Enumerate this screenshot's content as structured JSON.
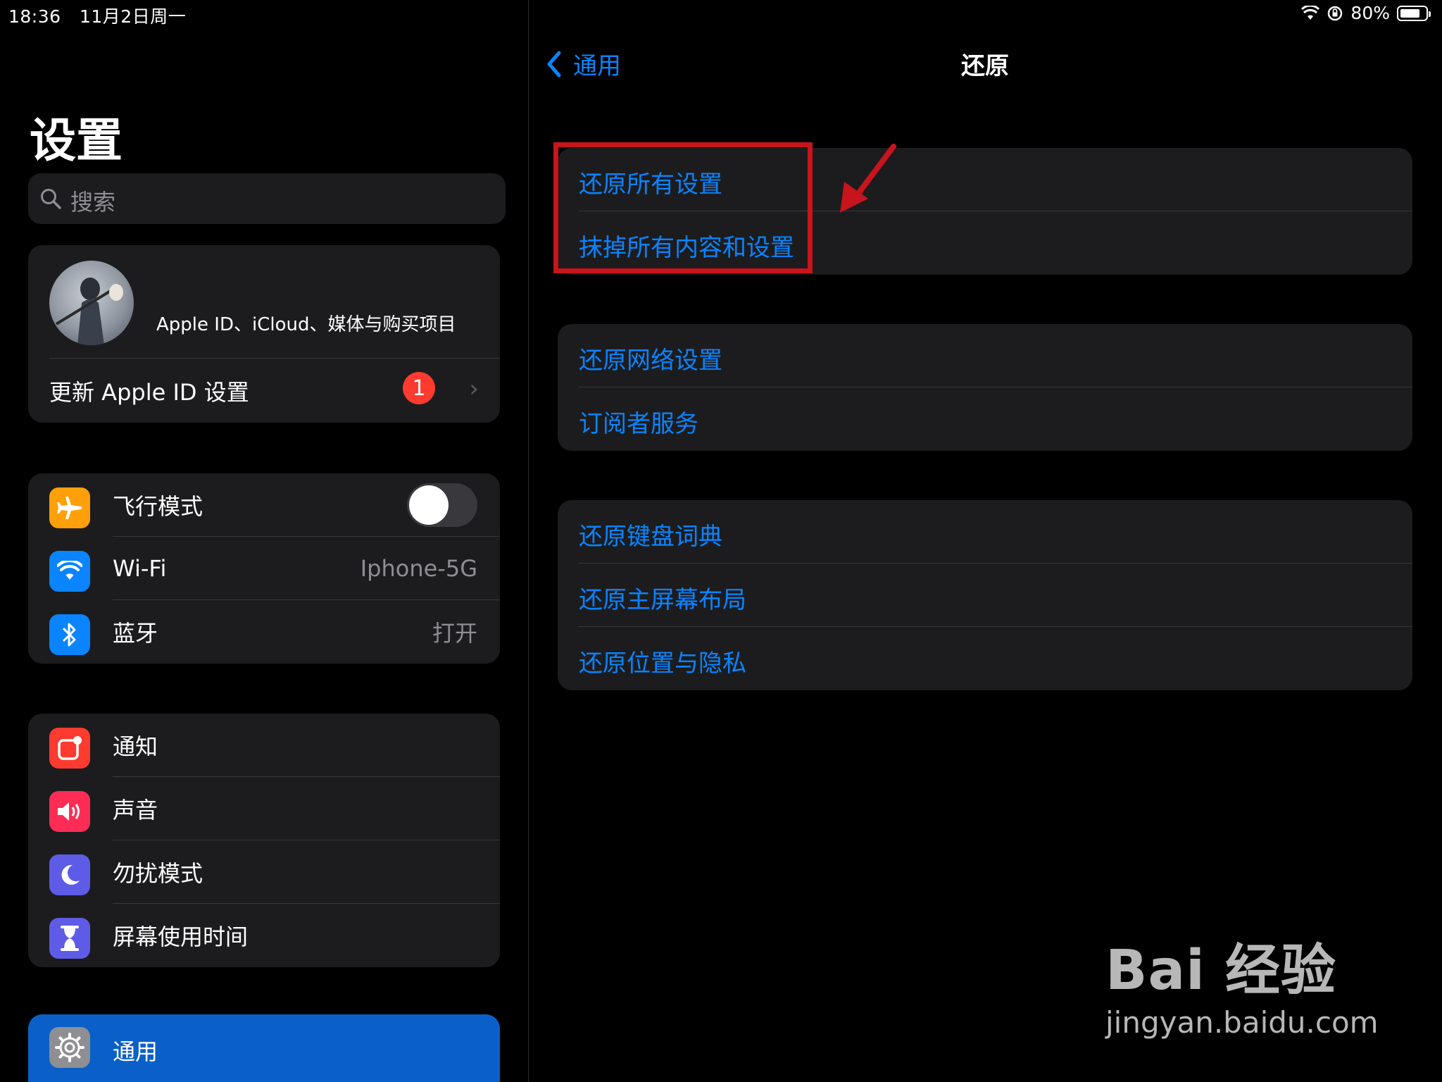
{
  "status_bar": {
    "time": "18:36",
    "date": "11月2日周一",
    "battery_pct": "80%",
    "battery_level": 0.8
  },
  "sidebar": {
    "title": "设置",
    "search_placeholder": "搜索",
    "profile": {
      "subtitle": "Apple ID、iCloud、媒体与购买项目",
      "update_label": "更新 Apple ID 设置",
      "badge_count": "1"
    },
    "connectivity": [
      {
        "label": "飞行模式",
        "value": "",
        "icon": "airplane-icon",
        "color": "#ff9f0a",
        "toggle_on": false
      },
      {
        "label": "Wi-Fi",
        "value": "Iphone-5G",
        "icon": "wifi-icon",
        "color": "#0a84ff"
      },
      {
        "label": "蓝牙",
        "value": "打开",
        "icon": "bluetooth-icon",
        "color": "#0a84ff"
      }
    ],
    "system": [
      {
        "label": "通知",
        "icon": "notifications-icon",
        "color": "#ff3b30"
      },
      {
        "label": "声音",
        "icon": "sound-icon",
        "color": "#ff2d55"
      },
      {
        "label": "勿扰模式",
        "icon": "moon-icon",
        "color": "#5e5ce6"
      },
      {
        "label": "屏幕使用时间",
        "icon": "hourglass-icon",
        "color": "#5e5ce6"
      }
    ],
    "selected": {
      "label": "通用",
      "icon": "gear-icon",
      "color": "#8e8e93"
    }
  },
  "detail": {
    "back_label": "通用",
    "title": "还原",
    "group1": [
      "还原所有设置",
      "抹掉所有内容和设置"
    ],
    "group2": [
      "还原网络设置",
      "订阅者服务"
    ],
    "group3": [
      "还原键盘词典",
      "还原主屏幕布局",
      "还原位置与隐私"
    ]
  },
  "watermark": {
    "brand": "Bai 经验",
    "url": "jingyan.baidu.com"
  },
  "colors": {
    "accent": "#0a84ff",
    "highlight_box": "#c8141c",
    "selected_row": "#0a60c8"
  }
}
